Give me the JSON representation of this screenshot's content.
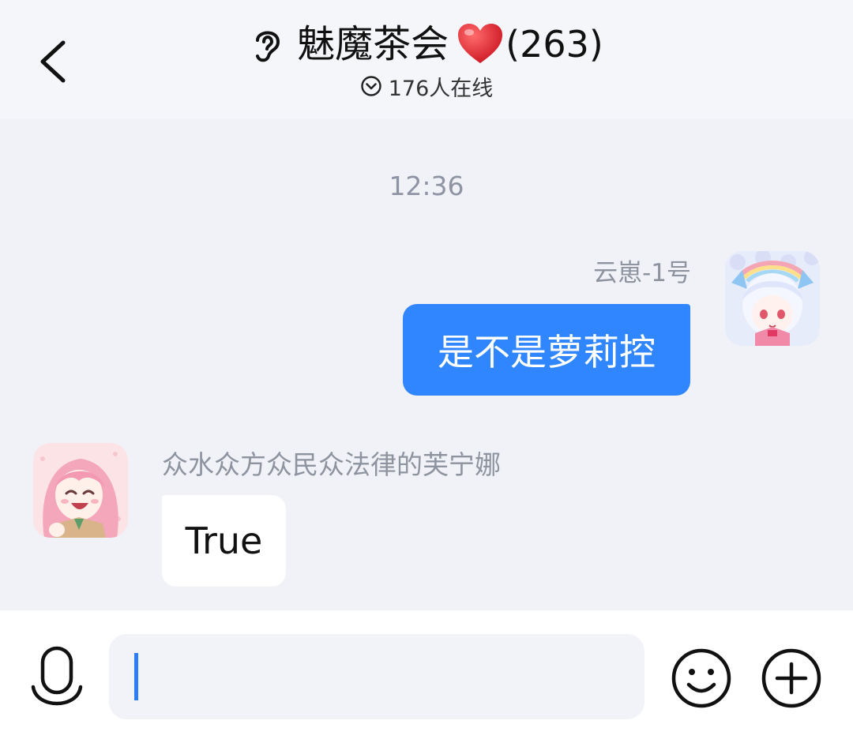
{
  "header": {
    "title": "魅魔茶会",
    "member_count": "(263)",
    "online_status": "176人在线"
  },
  "chat": {
    "timestamp": "12:36",
    "messages": [
      {
        "sender": "云崽-1号",
        "text": "是不是萝莉控",
        "side": "right"
      },
      {
        "sender": "众水众方众民众法律的芙宁娜",
        "text": "True",
        "side": "left"
      }
    ]
  },
  "input": {
    "value": ""
  },
  "icons": {
    "back": "chevron-left-icon",
    "ear": "ear-icon",
    "heart": "red-heart-emoji",
    "status": "chevron-down-circle-icon",
    "mic": "microphone-icon",
    "emoji": "smiley-icon",
    "plus": "plus-circle-icon"
  },
  "colors": {
    "accent": "#2f86ff",
    "background": "#f1f2f7",
    "header_bg": "#f5f6fa",
    "heart": "#e0202b",
    "muted_text": "#8d939f"
  }
}
